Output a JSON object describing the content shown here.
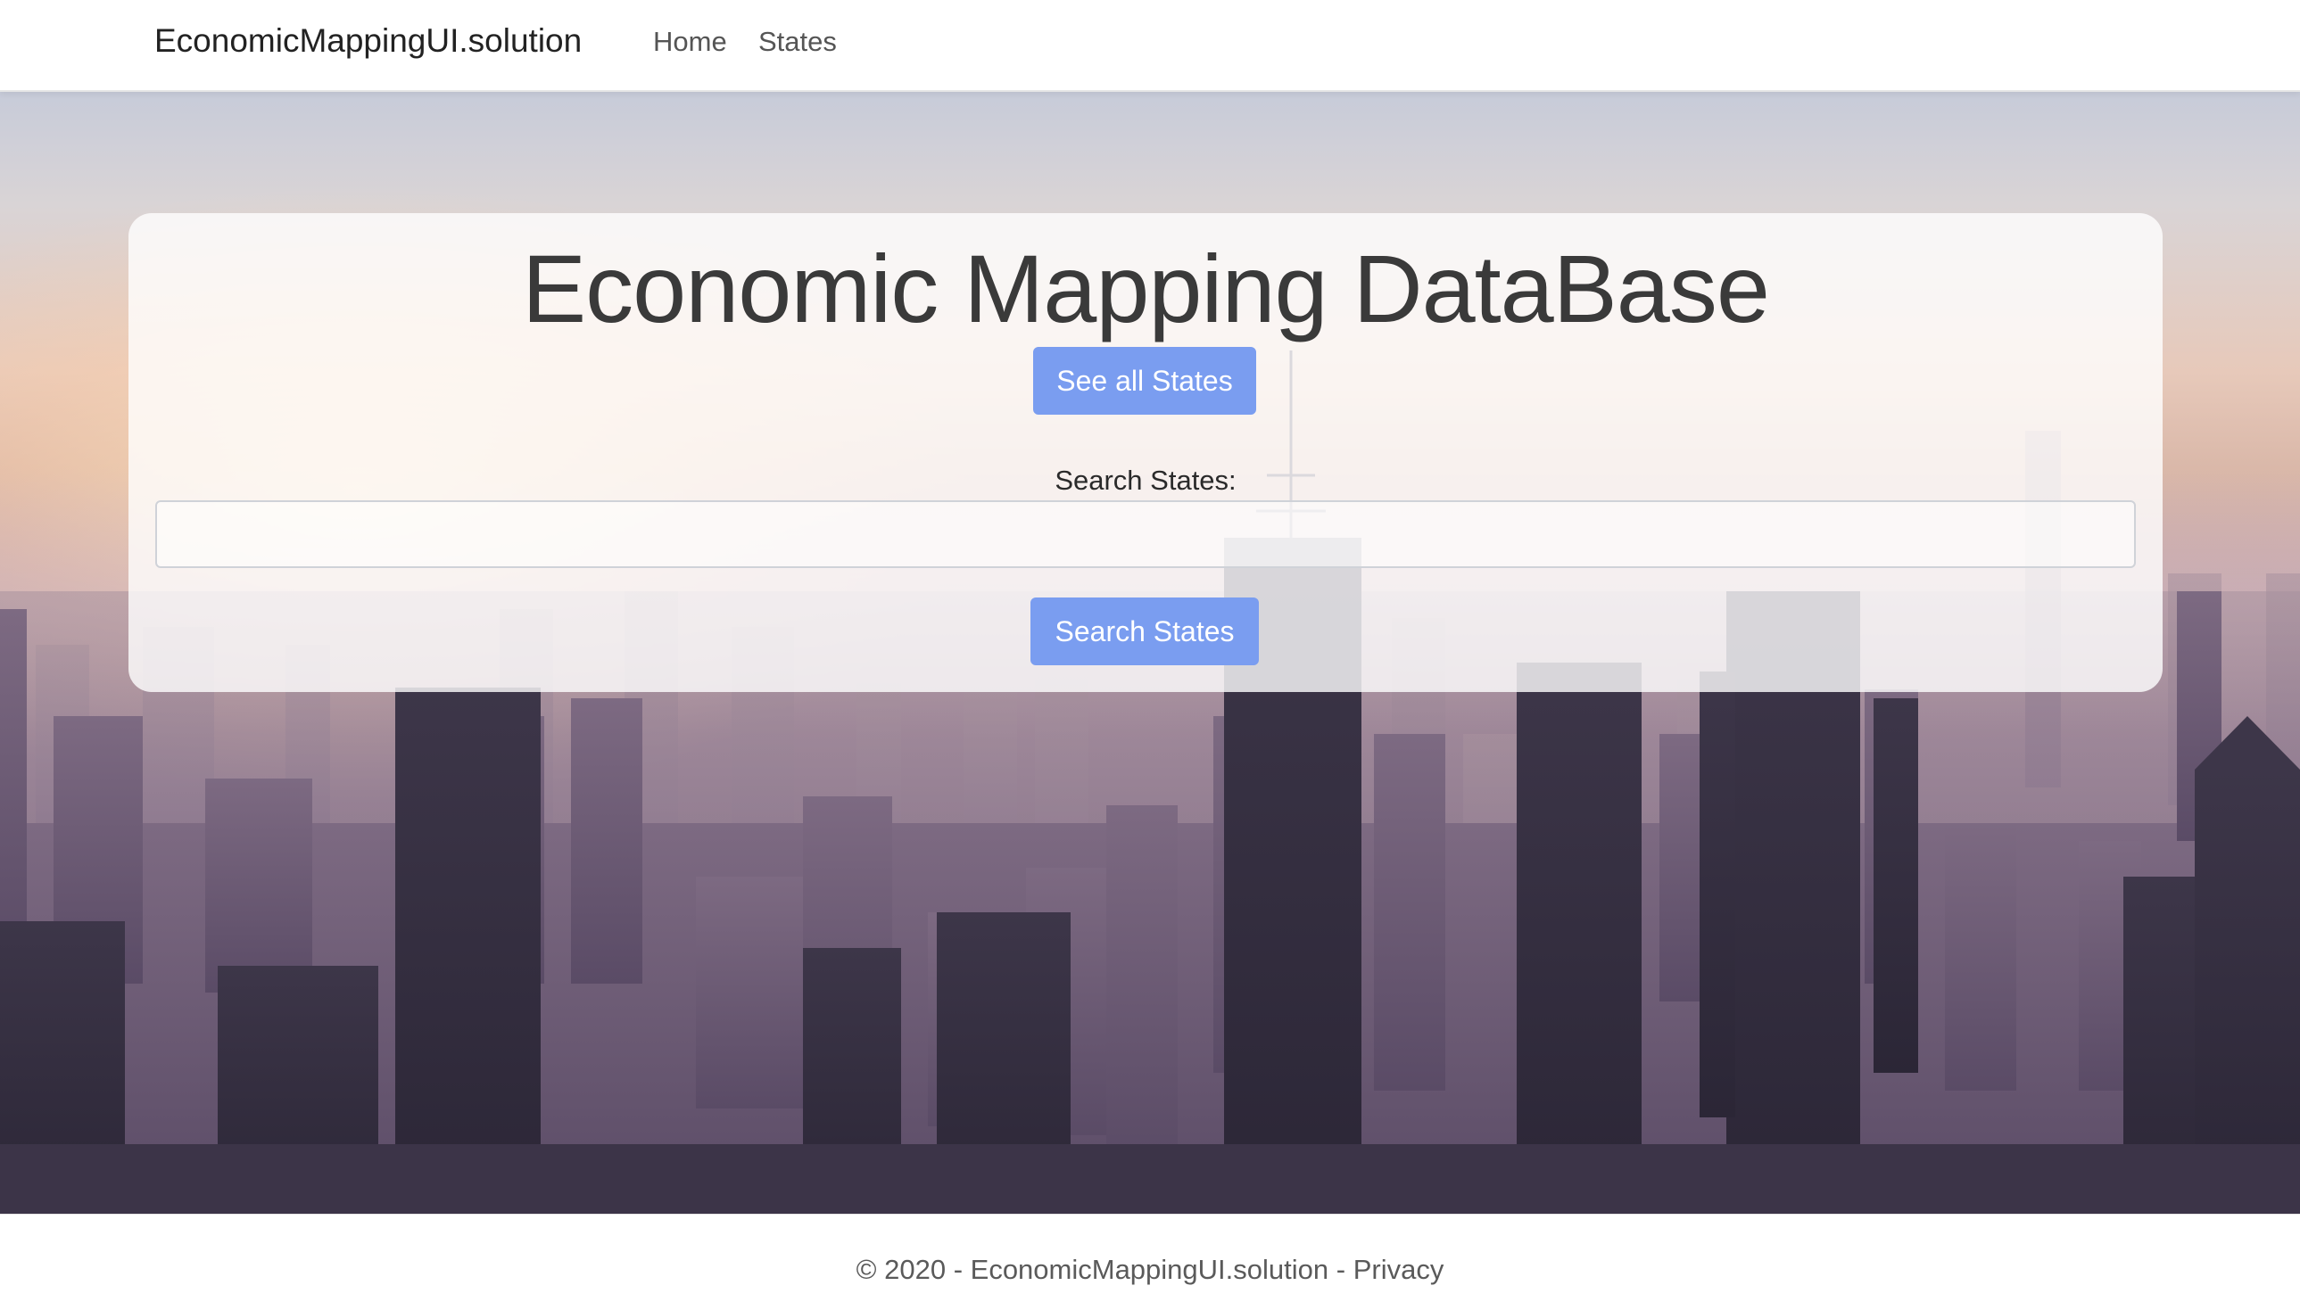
{
  "navbar": {
    "brand": "EconomicMappingUI.solution",
    "links": [
      "Home",
      "States"
    ]
  },
  "hero": {
    "title": "Economic Mapping DataBase",
    "see_all_button": "See all States",
    "search_label": "Search States:",
    "search_value": "",
    "search_placeholder": "",
    "search_button": "Search States"
  },
  "footer": {
    "copyright": "© 2020 - EconomicMappingUI.solution - ",
    "privacy_link": "Privacy"
  },
  "colors": {
    "button": "#7a9df0",
    "navbar_bg": "#ffffff",
    "title_text": "#3a3a3a"
  }
}
